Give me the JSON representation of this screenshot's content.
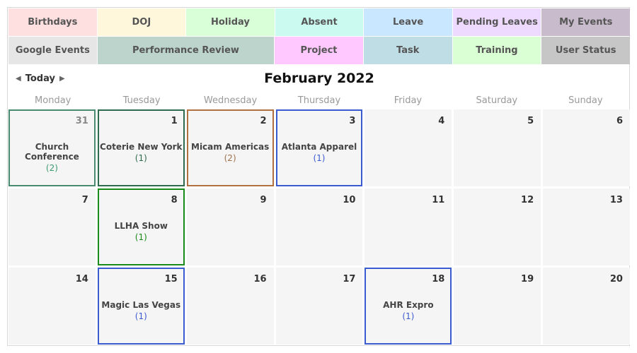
{
  "tabs": {
    "row1": [
      {
        "label": "Birthdays",
        "bg": "#ffe0e0"
      },
      {
        "label": "DOJ",
        "bg": "#fff7dc"
      },
      {
        "label": "Holiday",
        "bg": "#d9ffd9"
      },
      {
        "label": "Absent",
        "bg": "#cbfaf0"
      },
      {
        "label": "Leave",
        "bg": "#c9e7ff"
      },
      {
        "label": "Pending Leaves",
        "bg": "#eed9ff"
      },
      {
        "label": "My Events",
        "bg": "#c8bbcc"
      }
    ],
    "row2": [
      {
        "label": "Google Events",
        "bg": "#e6e6e6"
      },
      {
        "label": "Performance Review",
        "bg": "#bcd4cb"
      },
      {
        "label": "Project",
        "bg": "#ffc9ff"
      },
      {
        "label": "Task",
        "bg": "#bfdde4"
      },
      {
        "label": "Training",
        "bg": "#dbffd4"
      },
      {
        "label": "User Status",
        "bg": "#c6c6c6"
      }
    ]
  },
  "toolbar": {
    "prev_icon": "chevron-left-icon",
    "next_icon": "chevron-right-icon",
    "today_label": "Today",
    "title": "February 2022"
  },
  "weekdays": [
    "Monday",
    "Tuesday",
    "Wednesday",
    "Thursday",
    "Friday",
    "Saturday",
    "Sunday"
  ],
  "weeks": [
    [
      {
        "day": "31",
        "muted": true,
        "event": {
          "name": "Church Conference",
          "count": "(2)",
          "color": "#3a9a6e",
          "border": "#4a8a70"
        }
      },
      {
        "day": "1",
        "event": {
          "name": "Coterie New York",
          "count": "(1)",
          "color": "#2e6b4e",
          "border": "#2e6b4e"
        }
      },
      {
        "day": "2",
        "event": {
          "name": "Micam Americas",
          "count": "(2)",
          "color": "#a0704a",
          "border": "#b07040"
        }
      },
      {
        "day": "3",
        "event": {
          "name": "Atlanta Apparel",
          "count": "(1)",
          "color": "#3a5bd0",
          "border": "#3a5bd0"
        }
      },
      {
        "day": "4"
      },
      {
        "day": "5"
      },
      {
        "day": "6"
      }
    ],
    [
      {
        "day": "7"
      },
      {
        "day": "8",
        "event": {
          "name": "LLHA Show",
          "count": "(1)",
          "color": "#1a8a1a",
          "border": "#1a8a1a"
        }
      },
      {
        "day": "9"
      },
      {
        "day": "10"
      },
      {
        "day": "11"
      },
      {
        "day": "12"
      },
      {
        "day": "13"
      }
    ],
    [
      {
        "day": "14"
      },
      {
        "day": "15",
        "event": {
          "name": "Magic Las Vegas",
          "count": "(1)",
          "color": "#3a5bd0",
          "border": "#3a5bd0"
        }
      },
      {
        "day": "16"
      },
      {
        "day": "17"
      },
      {
        "day": "18",
        "event": {
          "name": "AHR Expro",
          "count": "(1)",
          "color": "#3a5bd0",
          "border": "#3a5bd0"
        }
      },
      {
        "day": "19"
      },
      {
        "day": "20"
      }
    ]
  ]
}
